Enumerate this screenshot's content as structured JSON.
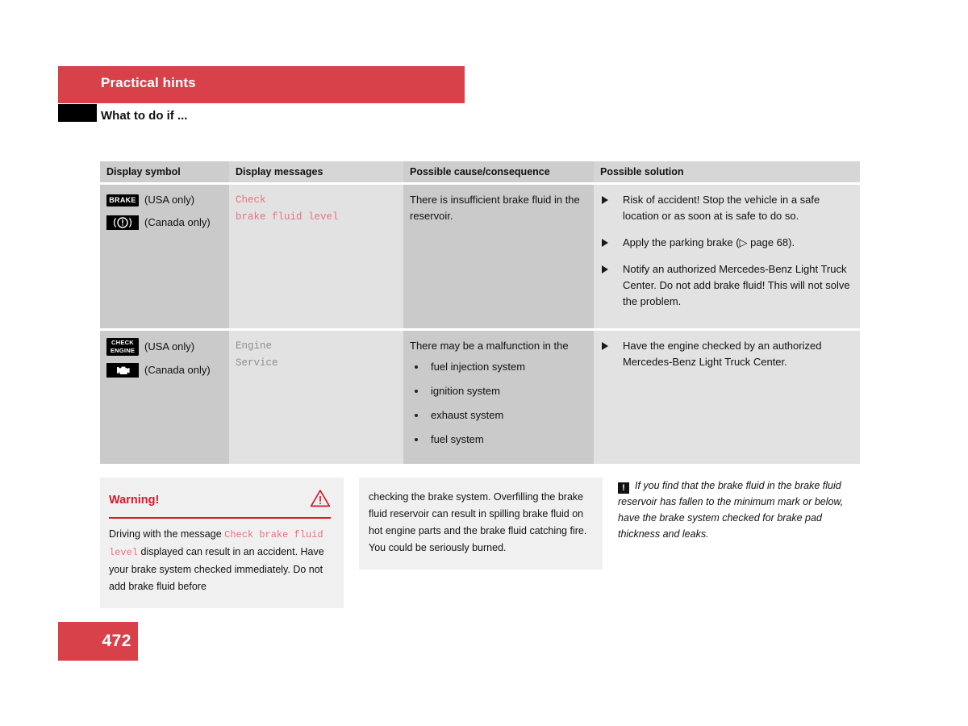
{
  "header": {
    "band_title": "Practical hints",
    "subtitle": "What to do if ..."
  },
  "table": {
    "columns": [
      "Display symbol",
      "Display messages",
      "Possible cause/consequence",
      "Possible solution"
    ],
    "rows": [
      {
        "symbols": [
          {
            "badge_type": "text",
            "badge_text": "BRAKE",
            "label": "(USA only)"
          },
          {
            "badge_type": "icon",
            "icon": "brake-warning-icon",
            "label": "(Canada only)"
          }
        ],
        "message_lines": [
          "Check",
          "brake fluid level"
        ],
        "message_color": "#e8737b",
        "cause": "There is insufficient brake fluid in the reservoir.",
        "cause_bullets": [],
        "solutions": [
          "Risk of accident! Stop the vehicle in a safe location or as soon at is safe to do so.",
          "Apply the parking brake (▷ page 68).",
          "Notify an authorized Mercedes-Benz Light Truck Center. Do not add brake fluid! This will not solve the problem."
        ]
      },
      {
        "symbols": [
          {
            "badge_type": "text2",
            "badge_text_line1": "CHECK",
            "badge_text_line2": "ENGINE",
            "label": "(USA only)"
          },
          {
            "badge_type": "icon",
            "icon": "check-engine-icon",
            "label": "(Canada only)"
          }
        ],
        "message_lines": [
          "Engine",
          "Service"
        ],
        "message_color": "#8d8d8d",
        "cause": "There may be a malfunction in the",
        "cause_bullets": [
          "fuel injection system",
          "ignition system",
          "exhaust system",
          "fuel system"
        ],
        "solutions": [
          "Have the engine checked by an authorized Mercedes-Benz Light Truck Center."
        ]
      }
    ]
  },
  "warning_box": {
    "title": "Warning!",
    "icon": "warning-triangle-icon",
    "text_part1": "Driving with the message ",
    "mono_text": "Check brake fluid level",
    "text_part2": " displayed can result in an accident. Have your brake system checked immediately. Do not add brake fluid before"
  },
  "continuation_box": {
    "text": "checking the brake system. Overfilling the brake fluid reservoir can result in spilling brake fluid on hot engine parts and the brake fluid catching fire. You could be seriously burned."
  },
  "note_box": {
    "icon": "exclamation-box-icon",
    "icon_glyph": "!",
    "text": "If you find that the brake fluid in the brake fluid reservoir has fallen to the minimum mark or below, have the brake system checked for brake pad thickness and leaks."
  },
  "footer": {
    "page_number": "472"
  },
  "colors": {
    "accent_red": "#d8404a",
    "warning_red": "#d8192b",
    "message_red": "#e8737b",
    "message_gray": "#8d8d8d",
    "cell_dark": "#cacaca",
    "cell_light": "#e2e2e2",
    "box_bg": "#f0f0f0"
  }
}
